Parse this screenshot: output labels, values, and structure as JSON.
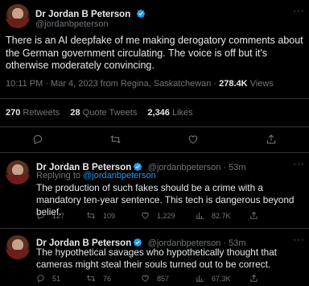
{
  "main_tweet": {
    "author_name": "Dr Jordan B Peterson",
    "handle": "@jordanbpeterson",
    "text": "There is an AI deepfake of me making derogatory comments about the German government circulating. The voice is off but it's otherwise moderately convincing.",
    "time": "10:11 PM · Mar 4, 2023 from Regina, Saskatchewan · ",
    "views_count": "278.4K",
    "views_label": " Views",
    "retweets_count": "270",
    "retweets_label": " Retweets",
    "quotes_count": "28",
    "quotes_label": " Quote Tweets",
    "likes_count": "2,346",
    "likes_label": " Likes"
  },
  "replies": [
    {
      "author_name": "Dr Jordan B Peterson",
      "handle_time": "@jordanbpeterson · 53m",
      "replying_prefix": "Replying to ",
      "replying_to": "@jordanbpeterson",
      "text": "The production of such fakes should be a crime with a mandatory ten-year sentence.  This tech is dangerous beyond belief.",
      "replies": "127",
      "retweets": "109",
      "likes": "1,229",
      "views": "82.7K"
    },
    {
      "author_name": "Dr Jordan B Peterson",
      "handle_time": "@jordanbpeterson · 53m",
      "text": "The hypothetical savages who hypothetically thought that cameras might steal their souls turned out to be correct.",
      "replies": "51",
      "retweets": "76",
      "likes": "857",
      "views": "67.3K"
    }
  ],
  "icons": [
    "verified-badge-icon",
    "more-icon",
    "reply-icon",
    "retweet-icon",
    "like-icon",
    "views-icon",
    "share-icon"
  ],
  "colors": {
    "background": "#000000",
    "text": "#e7e9ea",
    "muted": "#71767b",
    "accent": "#1d9bf0",
    "divider": "#2f3336"
  }
}
